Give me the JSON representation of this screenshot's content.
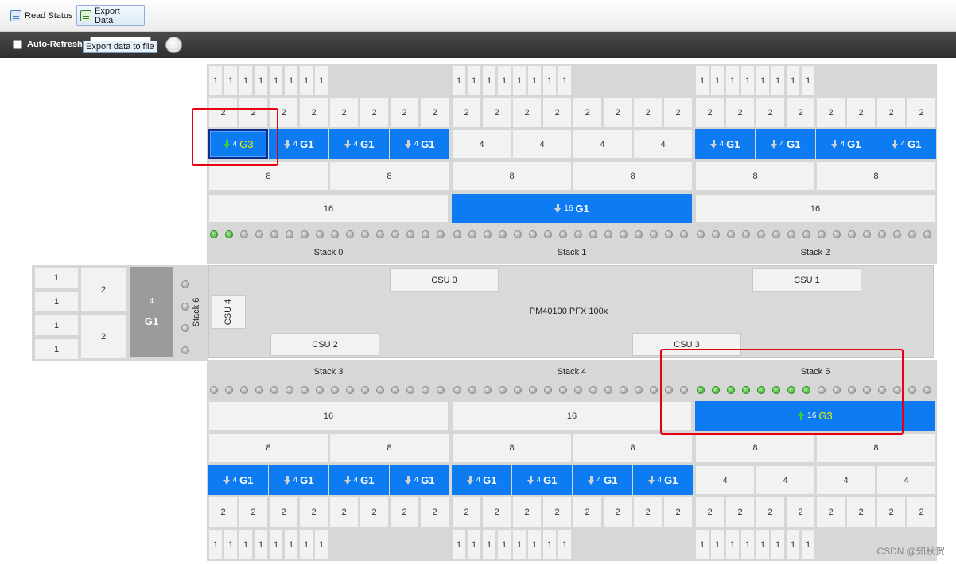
{
  "toolbar": {
    "read_status_label": "Read Status",
    "export_data_label": "Export Data",
    "export_tooltip": "Export data to file"
  },
  "refresh": {
    "auto_refresh_label": "Auto-Refresh",
    "auto_refresh_checked": false
  },
  "chassis": {
    "model_label": "PM40100 PFX 100x",
    "csu_labels": [
      "CSU 0",
      "CSU 1",
      "CSU 2",
      "CSU 3",
      "CSU 4"
    ]
  },
  "stacks": [
    {
      "name": "Stack 0",
      "leds_on": [
        0,
        1
      ]
    },
    {
      "name": "Stack 1",
      "leds_on": []
    },
    {
      "name": "Stack 2",
      "leds_on": []
    },
    {
      "name": "Stack 3",
      "leds_on": []
    },
    {
      "name": "Stack 4",
      "leds_on": []
    },
    {
      "name": "Stack 5",
      "leds_on": [
        0,
        1,
        2,
        3,
        4,
        5,
        6,
        7
      ]
    },
    {
      "name": "Stack 6",
      "leds_on": []
    }
  ],
  "partition_labels": {
    "size_1": "1",
    "size_2": "2",
    "size_4": "4",
    "size_8": "8",
    "size_16": "16"
  },
  "groups": {
    "g1": "G1",
    "g3": "G3"
  },
  "top_stacks": {
    "row4": [
      {
        "state": "g3-sel"
      },
      {
        "state": "g1"
      },
      {
        "state": "g1"
      },
      {
        "state": "g1"
      },
      {
        "state": "plain"
      },
      {
        "state": "plain"
      },
      {
        "state": "plain"
      },
      {
        "state": "plain"
      },
      {
        "state": "g1"
      },
      {
        "state": "g1"
      },
      {
        "state": "g1"
      },
      {
        "state": "g1"
      }
    ],
    "row16": [
      {
        "state": "plain"
      },
      {
        "state": "g1"
      },
      {
        "state": "plain"
      }
    ]
  },
  "bottom_stacks": {
    "row16": [
      {
        "state": "plain"
      },
      {
        "state": "plain"
      },
      {
        "state": "g3-up"
      }
    ],
    "row4": [
      {
        "state": "g1"
      },
      {
        "state": "g1"
      },
      {
        "state": "g1"
      },
      {
        "state": "g1"
      },
      {
        "state": "g1"
      },
      {
        "state": "g1"
      },
      {
        "state": "g1"
      },
      {
        "state": "g1"
      },
      {
        "state": "plain"
      },
      {
        "state": "plain"
      },
      {
        "state": "plain"
      },
      {
        "state": "plain"
      }
    ]
  },
  "side_stack": {
    "block4_group": "G1"
  },
  "watermark": "CSDN @知秋贺",
  "colors": {
    "assigned": "#0d7cf2",
    "led_on": "#2e9d25",
    "highlight": "#e60012",
    "g3_text": "#e6f000"
  }
}
